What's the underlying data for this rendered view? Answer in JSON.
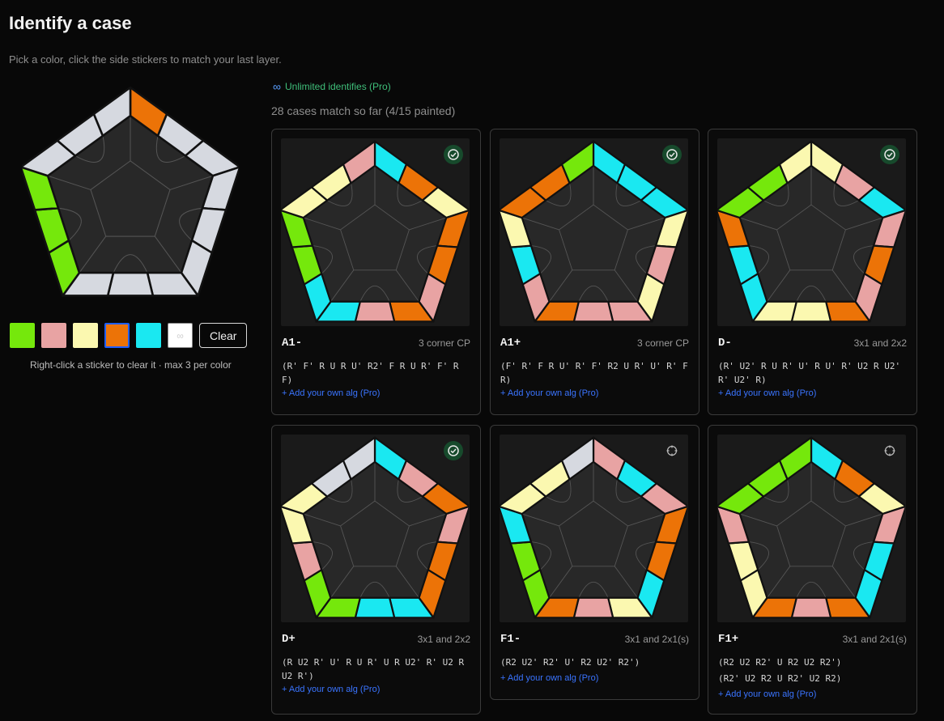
{
  "page": {
    "title": "Identify a case",
    "subtitle": "Pick a color, click the side stickers to match your last layer."
  },
  "colors": {
    "G": "#75e80c",
    "P": "#e8a3a3",
    "Y": "#fbf8b0",
    "O": "#ec7307",
    "C": "#1ae8f1",
    "W": "#d6d9e0",
    "face": "#282828",
    "accent": "#3a74ff"
  },
  "editor": {
    "stickers": [
      "O",
      "W",
      "W",
      "W",
      "W",
      "W",
      "W",
      "W",
      "W",
      "G",
      "G",
      "G",
      "W",
      "W",
      "W"
    ]
  },
  "palette": {
    "swatches": [
      {
        "name": "green",
        "color": "#75e80c",
        "selected": false
      },
      {
        "name": "pink",
        "color": "#e8a3a3",
        "selected": false
      },
      {
        "name": "yellow",
        "color": "#fbf8b0",
        "selected": false
      },
      {
        "name": "orange",
        "color": "#ec7307",
        "selected": true
      },
      {
        "name": "cyan",
        "color": "#1ae8f1",
        "selected": false
      },
      {
        "name": "white",
        "color": "#ffffff",
        "selected": false
      }
    ],
    "white_glyph": "∞",
    "clear_label": "Clear",
    "hint": "Right-click a sticker to clear it · max 3 per color"
  },
  "pro": {
    "unlimited_icon": "∞",
    "unlimited_text": "Unlimited identifies (Pro)"
  },
  "match_text": "28 cases match so far (4/15 painted)",
  "cases": [
    {
      "name": "A1-",
      "tag": "3 corner CP",
      "alg": [
        "(R' F' R U R U' R2' F R U R' F' R F)"
      ],
      "badge": "check",
      "add_label": "+ Add your own alg (Pro)",
      "stickers": [
        "C",
        "O",
        "Y",
        "O",
        "O",
        "P",
        "O",
        "P",
        "C",
        "C",
        "G",
        "G",
        "Y",
        "Y",
        "P"
      ]
    },
    {
      "name": "A1+",
      "tag": "3 corner CP",
      "alg": [
        "(F' R' F R U' R' F' R2 U R' U' R' F R)"
      ],
      "badge": "check",
      "add_label": "+ Add your own alg (Pro)",
      "stickers": [
        "C",
        "C",
        "C",
        "Y",
        "P",
        "Y",
        "P",
        "P",
        "O",
        "P",
        "C",
        "Y",
        "O",
        "O",
        "G",
        "G",
        "G"
      ]
    },
    {
      "name": "D-",
      "tag": "3x1 and 2x2",
      "alg": [
        "(R' U2' R U R' U' R U' R' U2 R U2' R' U2' R)"
      ],
      "badge": "check",
      "add_label": "+ Add your own alg (Pro)",
      "stickers": [
        "Y",
        "P",
        "C",
        "P",
        "O",
        "P",
        "O",
        "Y",
        "Y",
        "C",
        "C",
        "O",
        "G",
        "G",
        "Y"
      ]
    },
    {
      "name": "D+",
      "tag": "3x1 and 2x2",
      "alg": [
        "(R U2 R' U' R U R' U R U2' R' U2 R U2 R')"
      ],
      "badge": "check",
      "add_label": "+ Add your own alg (Pro)",
      "stickers": [
        "C",
        "P",
        "O",
        "P",
        "O",
        "O",
        "C",
        "C",
        "G",
        "G",
        "P",
        "Y",
        "Y"
      ]
    },
    {
      "name": "F1-",
      "tag": "3x1 and 2x1(s)",
      "alg": [
        "(R2 U2' R2' U' R2 U2' R2')"
      ],
      "badge": "add",
      "add_label": "+ Add your own alg (Pro)",
      "stickers": [
        "P",
        "C",
        "P",
        "O",
        "O",
        "C",
        "Y",
        "P",
        "O",
        "G",
        "G",
        "C",
        "Y",
        "Y"
      ]
    },
    {
      "name": "F1+",
      "tag": "3x1 and 2x1(s)",
      "alg": [
        "(R2 U2 R2' U R2 U2 R2')",
        "(R2' U2 R2 U R2' U2 R2)"
      ],
      "badge": "add",
      "add_label": "+ Add your own alg (Pro)",
      "stickers": [
        "C",
        "O",
        "Y",
        "P",
        "C",
        "C",
        "O",
        "P",
        "O",
        "Y",
        "Y",
        "P",
        "G",
        "G",
        "G"
      ]
    }
  ]
}
